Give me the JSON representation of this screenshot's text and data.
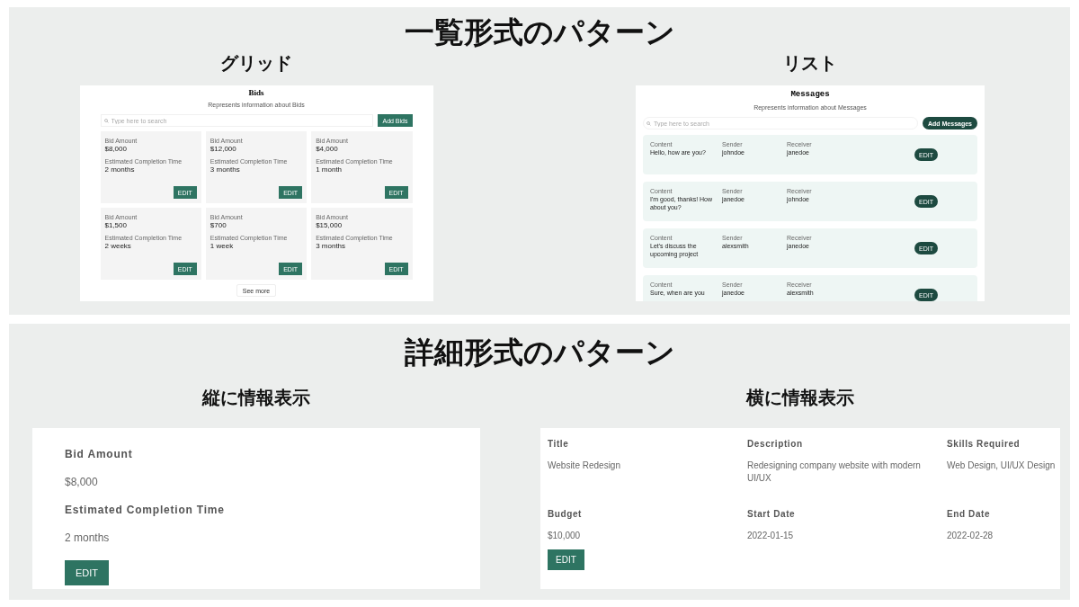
{
  "sections": [
    {
      "title": "一覧形式のパターン",
      "patterns": [
        {
          "kind": "grid",
          "caption": "グリッド",
          "screen": {
            "title": "Bids",
            "subtitle": "Represents information about Bids",
            "search_placeholder": "Type here to search",
            "add_button": "Add Bids",
            "more_button": "See more",
            "items": [
              {
                "fields": [
                  {
                    "label": "Bid Amount",
                    "value": "$8,000"
                  },
                  {
                    "label": "Estimated Completion Time",
                    "value": "2 months"
                  }
                ],
                "button": "EDIT"
              },
              {
                "fields": [
                  {
                    "label": "Bid Amount",
                    "value": "$12,000"
                  },
                  {
                    "label": "Estimated Completion Time",
                    "value": "3 months"
                  }
                ],
                "button": "EDIT"
              },
              {
                "fields": [
                  {
                    "label": "Bid Amount",
                    "value": "$4,000"
                  },
                  {
                    "label": "Estimated Completion Time",
                    "value": "1 month"
                  }
                ],
                "button": "EDIT"
              },
              {
                "fields": [
                  {
                    "label": "Bid Amount",
                    "value": "$1,500"
                  },
                  {
                    "label": "Estimated Completion Time",
                    "value": "2 weeks"
                  }
                ],
                "button": "EDIT"
              },
              {
                "fields": [
                  {
                    "label": "Bid Amount",
                    "value": "$700"
                  },
                  {
                    "label": "Estimated Completion Time",
                    "value": "1 week"
                  }
                ],
                "button": "EDIT"
              },
              {
                "fields": [
                  {
                    "label": "Bid Amount",
                    "value": "$15,000"
                  },
                  {
                    "label": "Estimated Completion Time",
                    "value": "3 months"
                  }
                ],
                "button": "EDIT"
              }
            ]
          }
        },
        {
          "kind": "list",
          "caption": "リスト",
          "screen": {
            "title": "Messages",
            "subtitle": "Represents information about Messages",
            "search_placeholder": "Type here to search",
            "add_button": "Add Messages",
            "items": [
              {
                "fields": [
                  {
                    "label": "Content",
                    "value": "Hello, how are you?"
                  },
                  {
                    "label": "Sender",
                    "value": "johndoe"
                  },
                  {
                    "label": "Receiver",
                    "value": "janedoe"
                  }
                ],
                "button": "EDIT"
              },
              {
                "fields": [
                  {
                    "label": "Content",
                    "value": "I'm good, thanks! How about you?"
                  },
                  {
                    "label": "Sender",
                    "value": "janedoe"
                  },
                  {
                    "label": "Receiver",
                    "value": "johndoe"
                  }
                ],
                "button": "EDIT"
              },
              {
                "fields": [
                  {
                    "label": "Content",
                    "value": "Let's discuss the upcoming project"
                  },
                  {
                    "label": "Sender",
                    "value": "alexsmith"
                  },
                  {
                    "label": "Receiver",
                    "value": "janedoe"
                  }
                ],
                "button": "EDIT"
              },
              {
                "fields": [
                  {
                    "label": "Content",
                    "value": "Sure, when are you"
                  },
                  {
                    "label": "Sender",
                    "value": "janedoe"
                  },
                  {
                    "label": "Receiver",
                    "value": "alexsmith"
                  }
                ],
                "button": "EDIT"
              }
            ]
          }
        }
      ]
    },
    {
      "title": "詳細形式のパターン",
      "patterns": [
        {
          "kind": "vertical",
          "caption": "縦に情報表示",
          "screen": {
            "fields": [
              {
                "label": "Bid Amount",
                "value": "$8,000"
              },
              {
                "label": "Estimated Completion Time",
                "value": "2 months"
              }
            ],
            "button": "EDIT"
          }
        },
        {
          "kind": "horizontal",
          "caption": "横に情報表示",
          "screen": {
            "fields": [
              {
                "label": "Title",
                "value": "Website Redesign"
              },
              {
                "label": "Description",
                "value": "Redesigning company website with modern UI/UX"
              },
              {
                "label": "Skills Required",
                "value": "Web Design, UI/UX Design"
              },
              {
                "label": "Budget",
                "value": "$10,000"
              },
              {
                "label": "Start Date",
                "value": "2022-01-15"
              },
              {
                "label": "End Date",
                "value": "2022-02-28"
              }
            ],
            "button": "EDIT"
          }
        }
      ]
    }
  ]
}
